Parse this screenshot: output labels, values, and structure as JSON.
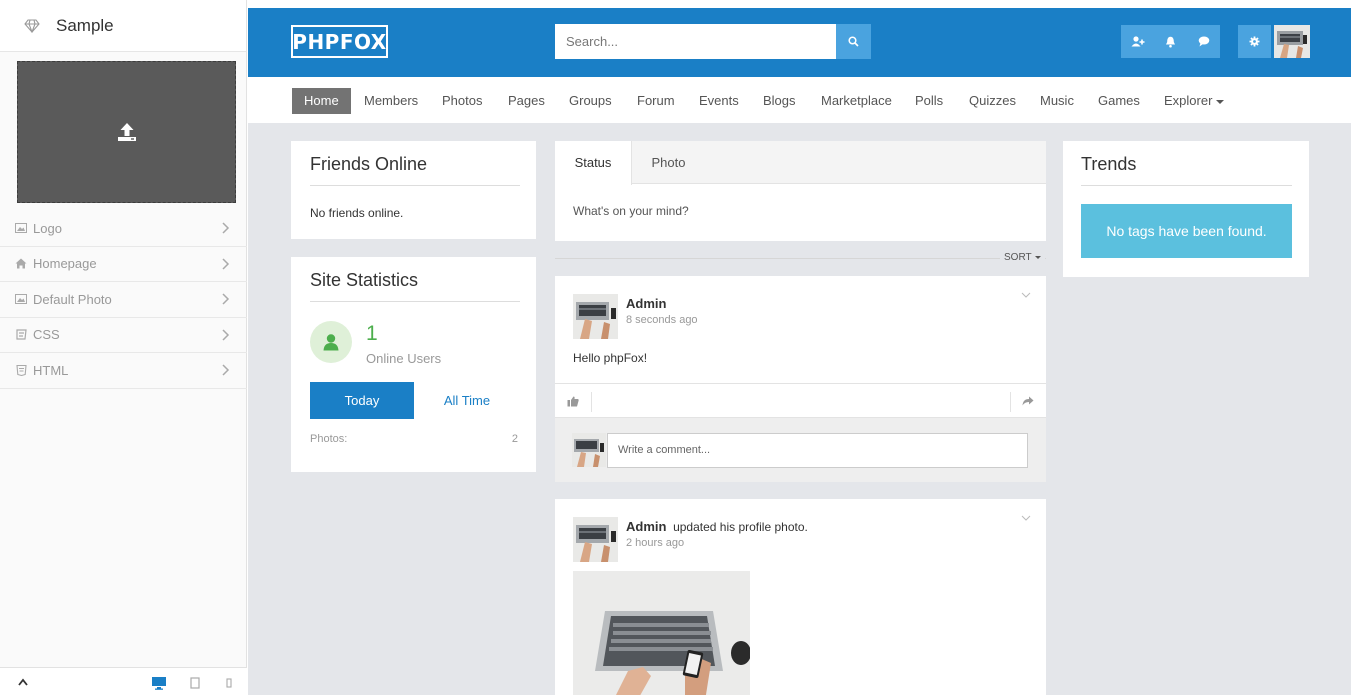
{
  "editor": {
    "title": "Sample",
    "menu": [
      {
        "label": "Logo",
        "icon": "image-icon"
      },
      {
        "label": "Homepage",
        "icon": "home-icon"
      },
      {
        "label": "Default Photo",
        "icon": "image-icon"
      },
      {
        "label": "CSS",
        "icon": "css-icon"
      },
      {
        "label": "HTML",
        "icon": "html-icon"
      }
    ]
  },
  "site": {
    "logo": "PHPFOX",
    "search_placeholder": "Search...",
    "nav": [
      "Home",
      "Members",
      "Photos",
      "Pages",
      "Groups",
      "Forum",
      "Events",
      "Blogs",
      "Marketplace",
      "Polls",
      "Quizzes",
      "Music",
      "Games",
      "Explorer"
    ],
    "colors": {
      "brand": "#1a7fc6",
      "accent": "#4aa3df",
      "info": "#5bc0de",
      "online_green": "#4cae4c"
    }
  },
  "friends_online": {
    "title": "Friends Online",
    "empty": "No friends online."
  },
  "site_statistics": {
    "title": "Site Statistics",
    "online_count": "1",
    "online_label": "Online Users",
    "tab_today": "Today",
    "tab_all_time": "All Time",
    "rows": [
      {
        "label": "Photos:",
        "value": "2"
      }
    ]
  },
  "composer": {
    "tab_status": "Status",
    "tab_photo": "Photo",
    "placeholder": "What's on your mind?"
  },
  "feed": {
    "sort_label": "SORT",
    "items": [
      {
        "author": "Admin",
        "action": "",
        "time": "8 seconds ago",
        "text": "Hello phpFox!",
        "comment_placeholder": "Write a comment..."
      },
      {
        "author": "Admin",
        "action": "updated his profile photo.",
        "time": "2 hours ago"
      }
    ]
  },
  "trends": {
    "title": "Trends",
    "empty": "No tags have been found."
  }
}
